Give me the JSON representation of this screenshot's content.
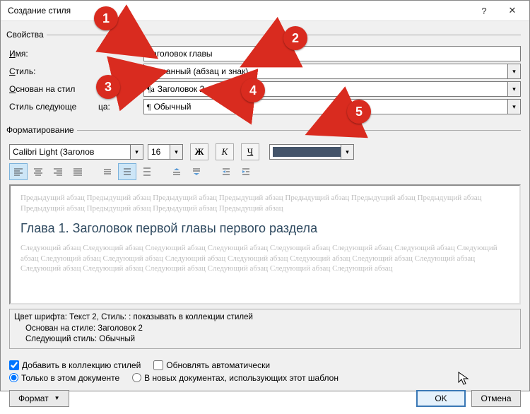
{
  "window": {
    "title": "Создание стиля"
  },
  "section": {
    "properties": "Свойства",
    "formatting": "Форматирование"
  },
  "labels": {
    "name": "Имя:",
    "style": "Стиль:",
    "based_on": "Основан на стил",
    "next_style_left": "Стиль следующе",
    "next_style_right": "ца:"
  },
  "underlines": {
    "name": "И",
    "style": "С",
    "based_on": "О"
  },
  "fields": {
    "name_value": "Заголовок главы",
    "style_value": "Связанный (абзац и знак)",
    "based_on_value": "Заголовок 2",
    "next_style_value": "Обычный"
  },
  "font": {
    "name": "Calibri Light (Заголов",
    "size": "16",
    "bold": "Ж",
    "italic": "К",
    "underline": "Ч",
    "color_hex": "#44546a"
  },
  "preview": {
    "prev_para": "Предыдущий абзац Предыдущий абзац Предыдущий абзац Предыдущий абзац Предыдущий абзац Предыдущий абзац Предыдущий абзац Предыдущий абзац Предыдущий абзац Предыдущий абзац Предыдущий абзац",
    "sample": "Глава 1. Заголовок первой главы первого раздела",
    "next_para": "Следующий абзац Следующий абзац Следующий абзац Следующий абзац Следующий абзац Следующий абзац Следующий абзац Следующий абзац Следующий абзац Следующий абзац Следующий абзац Следующий абзац Следующий абзац Следующий абзац Следующий абзац Следующий абзац Следующий абзац Следующий абзац Следующий абзац Следующий абзац Следующий абзац"
  },
  "summary": {
    "line1": "Цвет шрифта: Текст 2, Стиль: : показывать в коллекции стилей",
    "line2": "Основан на стиле: Заголовок 2",
    "line3": "Следующий стиль: Обычный"
  },
  "options": {
    "add_to_gallery": "Добавить в коллекцию стилей",
    "auto_update": "Обновлять автоматически",
    "only_this_doc": "Только в этом документе",
    "new_docs": "В новых документах, использующих этот шаблон"
  },
  "buttons": {
    "format": "Формат",
    "ok": "OK",
    "cancel": "Отмена"
  },
  "callouts": {
    "c1": "1",
    "c2": "2",
    "c3": "3",
    "c4": "4",
    "c5": "5"
  }
}
